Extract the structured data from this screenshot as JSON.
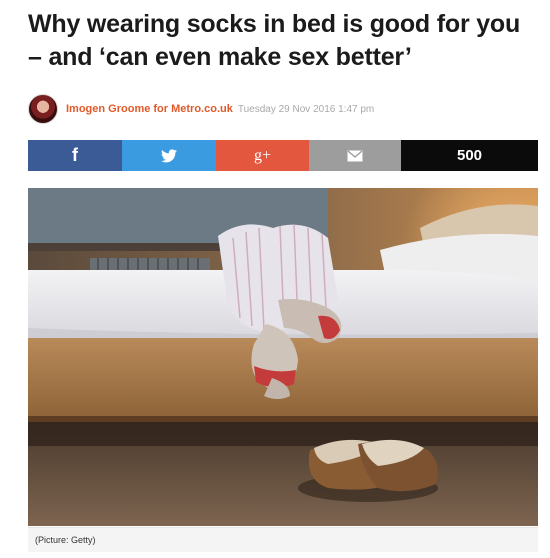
{
  "article": {
    "headline": "Why wearing socks in bed is good for you – and ‘can even make sex better’",
    "author": "Imogen Groome for Metro.co.uk",
    "date": "Tuesday 29 Nov 2016 1:47 pm"
  },
  "share_bar": {
    "facebook_icon": "f",
    "googleplus_icon": "g+",
    "count": "500",
    "colors": {
      "facebook": "#3b5b97",
      "twitter": "#3a9be0",
      "googleplus": "#e4573f",
      "email": "#9d9d9d",
      "count": "#0b0b0b"
    },
    "icons": [
      "facebook-icon",
      "twitter-icon",
      "googleplus-icon",
      "email-icon"
    ]
  },
  "image": {
    "caption": "(Picture: Getty)"
  },
  "theme": {
    "byline_color": "#e25a2a"
  }
}
